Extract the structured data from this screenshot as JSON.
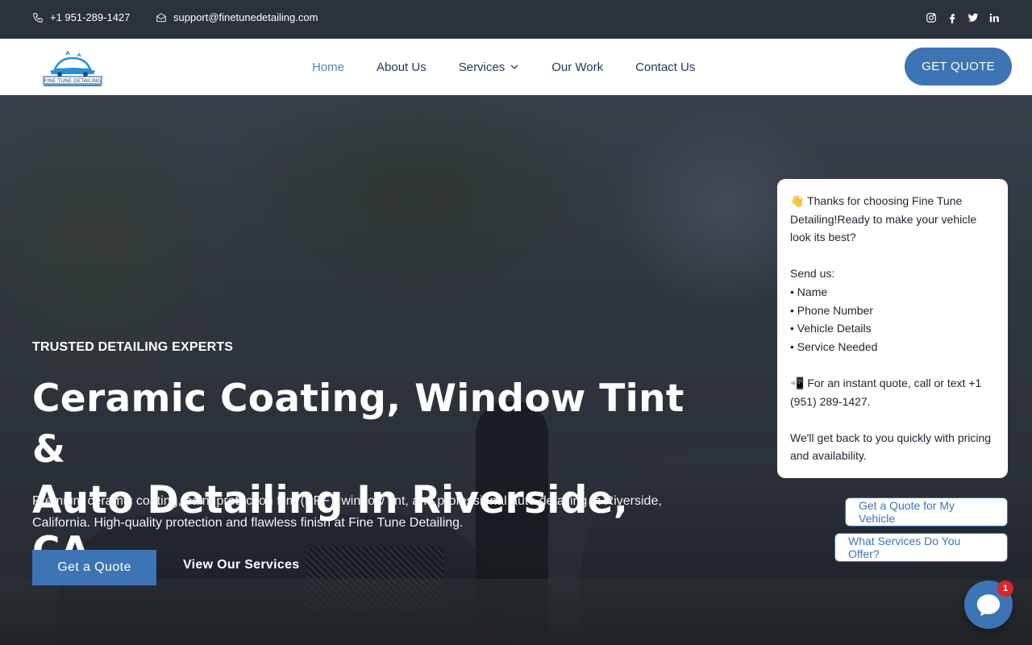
{
  "topbar": {
    "phone": "+1 951-289-1427",
    "email": "support@finetunedetailing.com",
    "social_icons": [
      "instagram-icon",
      "facebook-icon",
      "twitter-icon",
      "linkedin-icon"
    ]
  },
  "nav": {
    "logo_text": "FINE TUNE DETAILING",
    "items": [
      {
        "label": "Home",
        "active": true
      },
      {
        "label": "About Us"
      },
      {
        "label": "Services",
        "has_dropdown": true
      },
      {
        "label": "Our Work"
      },
      {
        "label": "Contact Us"
      }
    ],
    "cta_label": "GET QUOTE"
  },
  "hero": {
    "eyebrow": "TRUSTED DETAILING EXPERTS",
    "headline_line1": "Ceramic Coating, Window Tint &",
    "headline_line2": "Auto Detailing In Riverside, CA",
    "subtext": "Premium ceramic coating, paint protection film (PPF), window tint, and professional auto detailing in Riverside, California. High-quality protection and flawless finish at Fine Tune Detailing.",
    "primary_button": "Get a Quote",
    "secondary_button": "View Our Services"
  },
  "chat": {
    "message": "👋 Thanks for choosing Fine Tune Detailing!Ready to make your vehicle look its best?\n\nSend us:\n• Name\n• Phone Number\n• Vehicle Details\n• Service Needed\n\n📲 For an instant quote, call or text +1 (951) 289-1427.\n\nWe'll get back to you quickly with pricing and availability.",
    "quick_replies": [
      "Get a Quote for My Vehicle",
      "What Services Do You Offer?"
    ],
    "unread_count": "1"
  },
  "colors": {
    "topbar_bg": "#2b323b",
    "accent": "#3d74b3",
    "nav_text": "#1f3553",
    "nav_active": "#4f86c1",
    "badge": "#d9252c"
  }
}
